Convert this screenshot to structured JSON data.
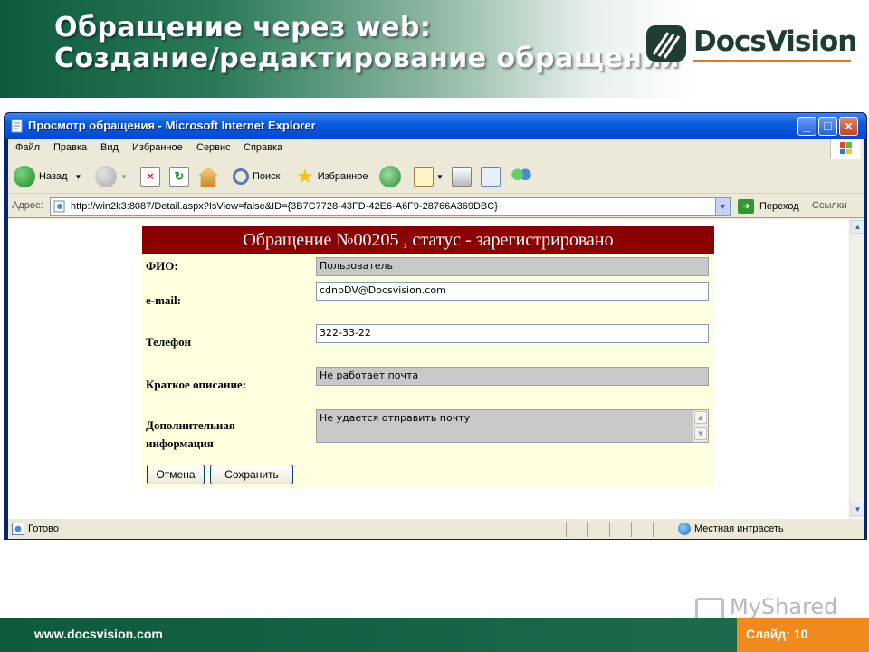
{
  "slide": {
    "title_line1": "Обращение через web:",
    "title_line2": "Создание/редактирование обращения",
    "logo_text": "DocsVision",
    "footer_url": "www.docsvision.com",
    "slide_number": "Слайд: 10",
    "watermark": "MyShared"
  },
  "browser": {
    "window_title": "Просмотр обращения - Microsoft Internet Explorer",
    "menu": [
      {
        "label": "Файл"
      },
      {
        "label": "Правка"
      },
      {
        "label": "Вид"
      },
      {
        "label": "Избранное"
      },
      {
        "label": "Сервис"
      },
      {
        "label": "Справка"
      }
    ],
    "toolbar": {
      "back": "Назад",
      "search": "Поиск",
      "favorites": "Избранное"
    },
    "address": {
      "label": "Адрес:",
      "url": "http://win2k3:8087/Detail.aspx?IsView=false&ID={3B7C7728-43FD-42E6-A6F9-28766A369DBC}",
      "go": "Переход",
      "links": "Ссылки"
    },
    "status": {
      "text": "Готово",
      "zone": "Местная интрасеть"
    }
  },
  "form": {
    "header": "Обращение №00205 , статус - зарегистрировано",
    "fio_label": "ФИО:",
    "fio_value": "Пользователь",
    "email_label": "e-mail:",
    "email_value": "cdnbDV@Docsvision.com",
    "phone_label": "Телефон",
    "phone_value": "322-33-22",
    "summary_label": "Краткое описание:",
    "summary_value": "Не работает почта",
    "details_label_1": "Дополнительная",
    "details_label_2": "информация",
    "details_value": "Не удается отправить почту",
    "cancel": "Отмена",
    "save": "Сохранить"
  },
  "colors": {
    "brand_green": "#0e5a3d",
    "accent_orange": "#f08a1c",
    "form_header": "#8b0000",
    "form_bg": "#ffffe0",
    "xp_titlebar": "#0348cf"
  }
}
